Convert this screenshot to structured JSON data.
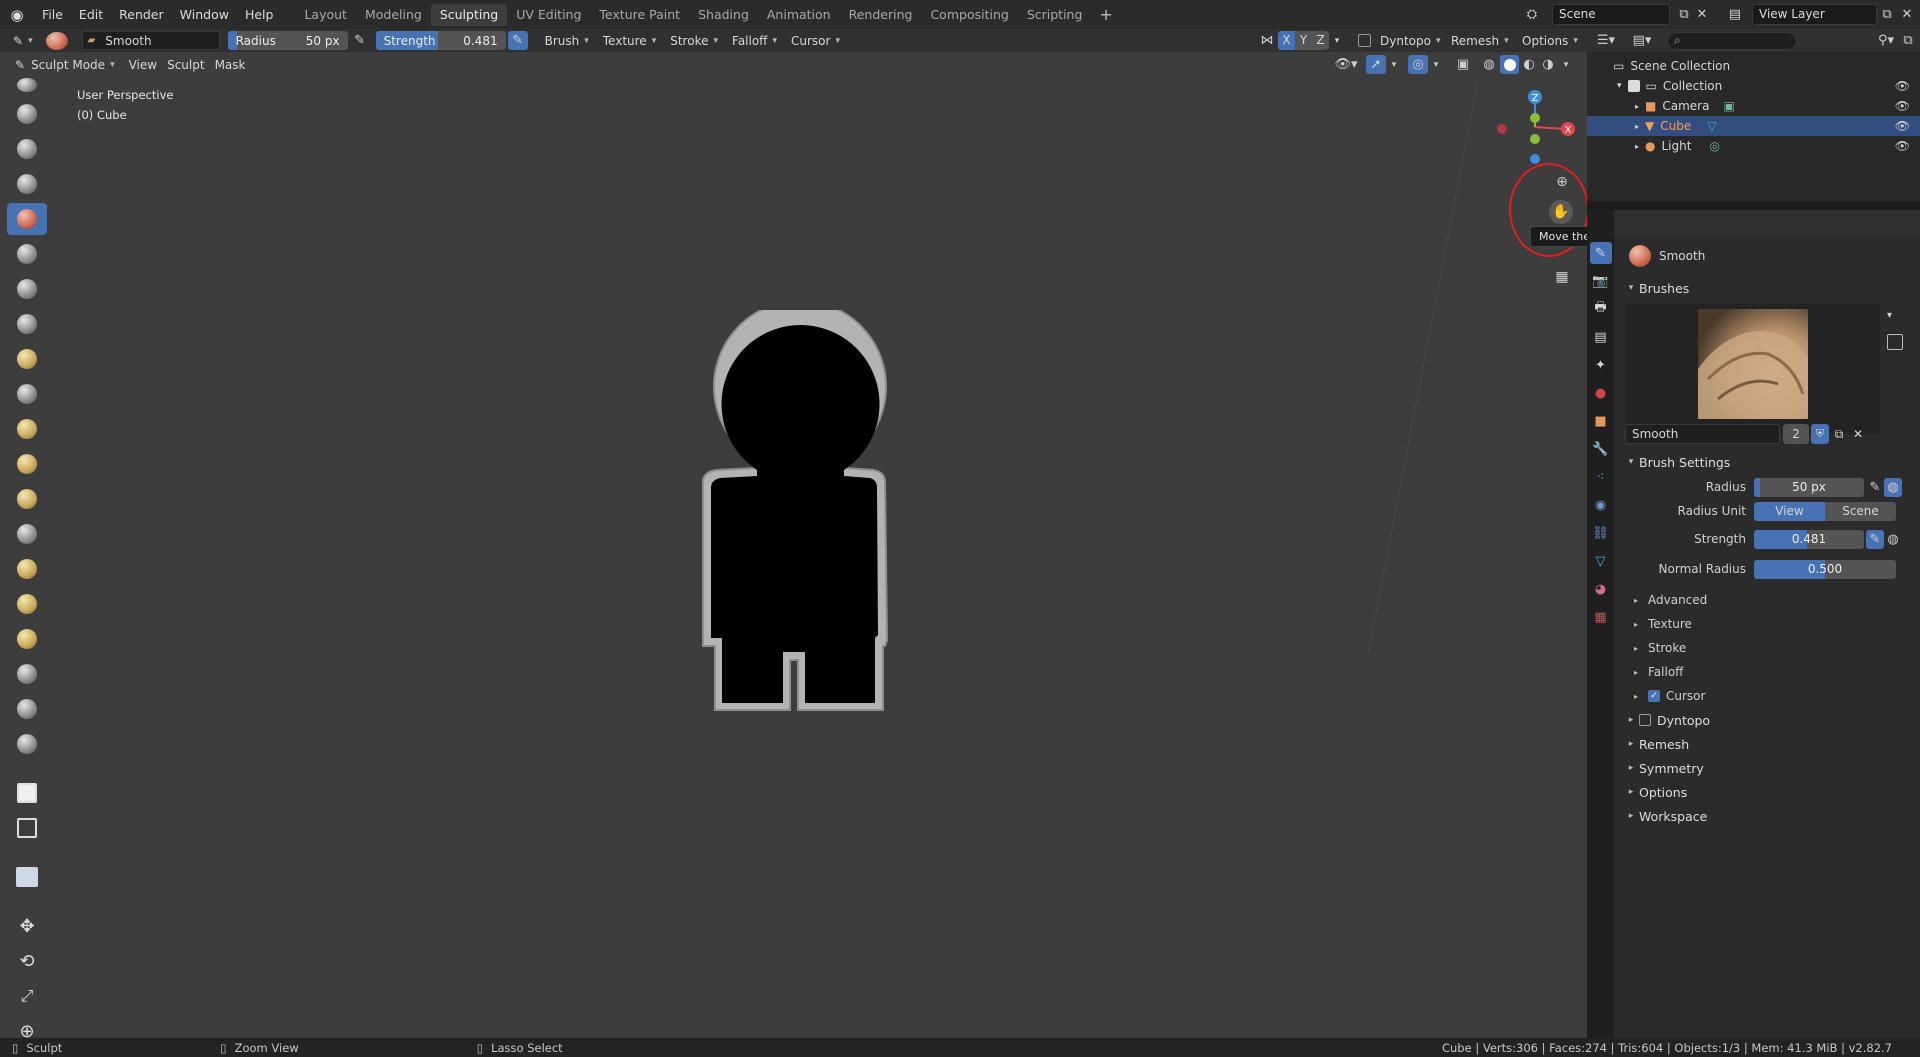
{
  "menu": [
    "File",
    "Edit",
    "Render",
    "Window",
    "Help"
  ],
  "workspaces": [
    {
      "label": "Layout",
      "active": false
    },
    {
      "label": "Modeling",
      "active": false
    },
    {
      "label": "Sculpting",
      "active": true
    },
    {
      "label": "UV Editing",
      "active": false
    },
    {
      "label": "Texture Paint",
      "active": false
    },
    {
      "label": "Shading",
      "active": false
    },
    {
      "label": "Animation",
      "active": false
    },
    {
      "label": "Rendering",
      "active": false
    },
    {
      "label": "Compositing",
      "active": false
    },
    {
      "label": "Scripting",
      "active": false
    }
  ],
  "scene": {
    "name": "Scene",
    "view_layer": "View Layer"
  },
  "header": {
    "brush_name": "Smooth",
    "radius_label": "Radius",
    "radius_value": "50 px",
    "strength_label": "Strength",
    "strength_value": "0.481",
    "strength_fraction": 0.481,
    "dropdowns": [
      "Brush",
      "Texture",
      "Stroke",
      "Falloff",
      "Cursor"
    ],
    "axes": [
      "X",
      "Y",
      "Z"
    ],
    "dyntopo": "Dyntopo",
    "remesh": "Remesh",
    "options": "Options"
  },
  "viewport": {
    "mode": "Sculpt Mode",
    "menus": [
      "View",
      "Sculpt",
      "Mask"
    ],
    "perspective": "User Perspective",
    "object": "(0) Cube",
    "tooltip": "Move the view",
    "gizmo": {
      "x": "X",
      "y": "Y",
      "z": "Z"
    }
  },
  "outliner": {
    "root": "Scene Collection",
    "collection": "Collection",
    "items": [
      {
        "name": "Camera",
        "selected": false
      },
      {
        "name": "Cube",
        "selected": true
      },
      {
        "name": "Light",
        "selected": false
      }
    ]
  },
  "properties": {
    "brush_title": "Smooth",
    "brushes_header": "Brushes",
    "brush_field": "Smooth",
    "brush_users": "2",
    "brush_settings_header": "Brush Settings",
    "radius_label": "Radius",
    "radius_value": "50 px",
    "radius_unit_label": "Radius Unit",
    "unit_view": "View",
    "unit_scene": "Scene",
    "strength_label": "Strength",
    "strength_value": "0.481",
    "strength_fraction": 0.481,
    "normal_radius_label": "Normal Radius",
    "normal_radius_value": "0.500",
    "normal_radius_fraction": 0.5,
    "subpanels": [
      "Advanced",
      "Texture",
      "Stroke",
      "Falloff",
      "Cursor"
    ],
    "panels": [
      "Dyntopo",
      "Remesh",
      "Symmetry",
      "Options",
      "Workspace"
    ]
  },
  "status": {
    "left": "Sculpt",
    "middle": "Zoom View",
    "right": "Lasso Select",
    "stats": "Cube | Verts:306 | Faces:274 | Tris:604 | Objects:1/3 | Mem: 41.3 MiB | v2.82.7"
  },
  "colors": {
    "accent": "#4772b3",
    "selected_row": "#334d80",
    "object_orange": "#f0a35a",
    "gizmo_x": "#e74553",
    "gizmo_y": "#8bbd3b",
    "gizmo_z": "#3f8edd"
  }
}
